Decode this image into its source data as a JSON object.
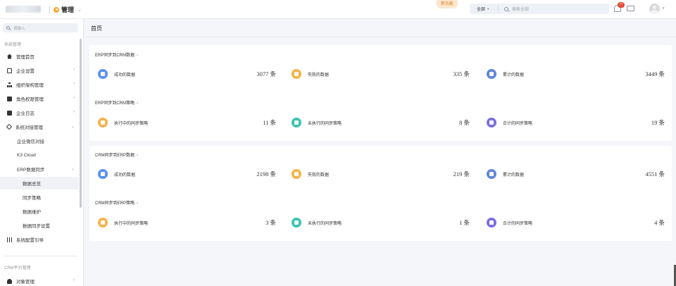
{
  "header": {
    "app_title": "管理",
    "new_feature": "新功能",
    "search_scope": "全部",
    "search_placeholder": "搜索全部",
    "notification_count": "77"
  },
  "sidebar": {
    "search_placeholder": "请输入",
    "group_system": "系统管理",
    "items": [
      {
        "label": "管理首页"
      },
      {
        "label": "企业设置"
      },
      {
        "label": "组织架构管理"
      },
      {
        "label": "角色权限管理"
      },
      {
        "label": "企业日志"
      },
      {
        "label": "系统对接管理"
      },
      {
        "label": "企业微信对接"
      },
      {
        "label": "K3 Cloud"
      },
      {
        "label": "ERP数据同步"
      },
      {
        "label": "数据总览"
      },
      {
        "label": "同步策略"
      },
      {
        "label": "数据维护"
      },
      {
        "label": "数据同步设置"
      },
      {
        "label": "系统配置引导"
      }
    ],
    "group_crm": "CRM平台管理",
    "crm_item": "对象管理"
  },
  "main": {
    "page_title": "首页",
    "panels": [
      {
        "sections": [
          {
            "title": "ERP同步到CRM数据",
            "stats": [
              {
                "label": "成功的数据",
                "value": "3077 条",
                "color": "#5b8ff9"
              },
              {
                "label": "失败的数据",
                "value": "335 条",
                "color": "#f7b24a"
              },
              {
                "label": "累计的数据",
                "value": "3449 条",
                "color": "#5f86d8"
              }
            ]
          },
          {
            "title": "ERP同步到CRM策略",
            "stats": [
              {
                "label": "执行中的同步策略",
                "value": "11 条",
                "color": "#f7b24a"
              },
              {
                "label": "未执行的同步策略",
                "value": "8 条",
                "color": "#3cc2b3"
              },
              {
                "label": "合计的同步策略",
                "value": "19 条",
                "color": "#7a6fe0"
              }
            ]
          }
        ]
      },
      {
        "sections": [
          {
            "title": "CRM同步到ERP数据",
            "stats": [
              {
                "label": "成功的数据",
                "value": "2198 条",
                "color": "#5b8ff9"
              },
              {
                "label": "失败的数据",
                "value": "219 条",
                "color": "#f7b24a"
              },
              {
                "label": "累计的数据",
                "value": "4551 条",
                "color": "#5f86d8"
              }
            ]
          },
          {
            "title": "CRM同步到ERP策略",
            "stats": [
              {
                "label": "执行中的同步策略",
                "value": "3 条",
                "color": "#f7b24a"
              },
              {
                "label": "未执行的同步策略",
                "value": "1 条",
                "color": "#3cc2b3"
              },
              {
                "label": "合计的同步策略",
                "value": "4 条",
                "color": "#7a6fe0"
              }
            ]
          }
        ]
      }
    ]
  }
}
